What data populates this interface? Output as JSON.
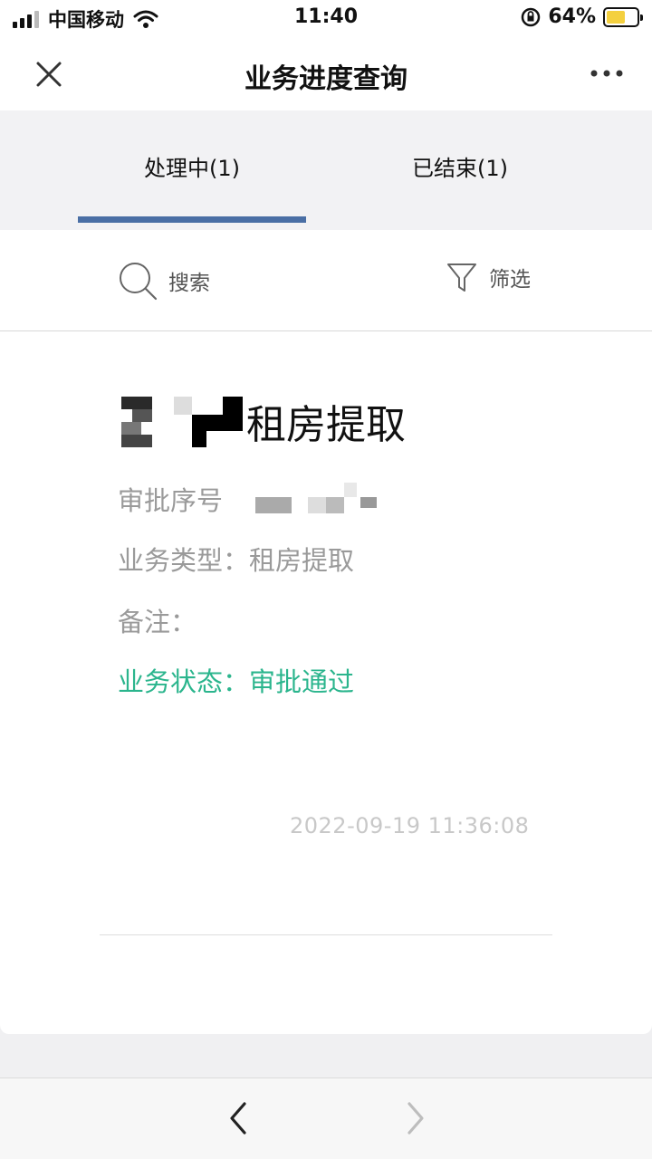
{
  "status_bar": {
    "carrier": "中国移动",
    "time": "11:40",
    "battery": "64%",
    "battery_level": 0.64
  },
  "header": {
    "title": "业务进度查询"
  },
  "tabs": [
    {
      "label": "处理中(1)",
      "active": true
    },
    {
      "label": "已结束(1)",
      "active": false
    }
  ],
  "toolbar": {
    "search_label": "搜索",
    "filter_label": "筛选"
  },
  "record": {
    "title": "租房提取",
    "approval_no_label": "审批序号",
    "type_label": "业务类型：",
    "type_value": "租房提取",
    "remark_label": "备注：",
    "status_label": "业务状态：",
    "status_value": "审批通过",
    "timestamp": "2022-09-19 11:36:08"
  },
  "colors": {
    "accent": "#4a6fa5",
    "status_ok": "#2bb58d"
  }
}
